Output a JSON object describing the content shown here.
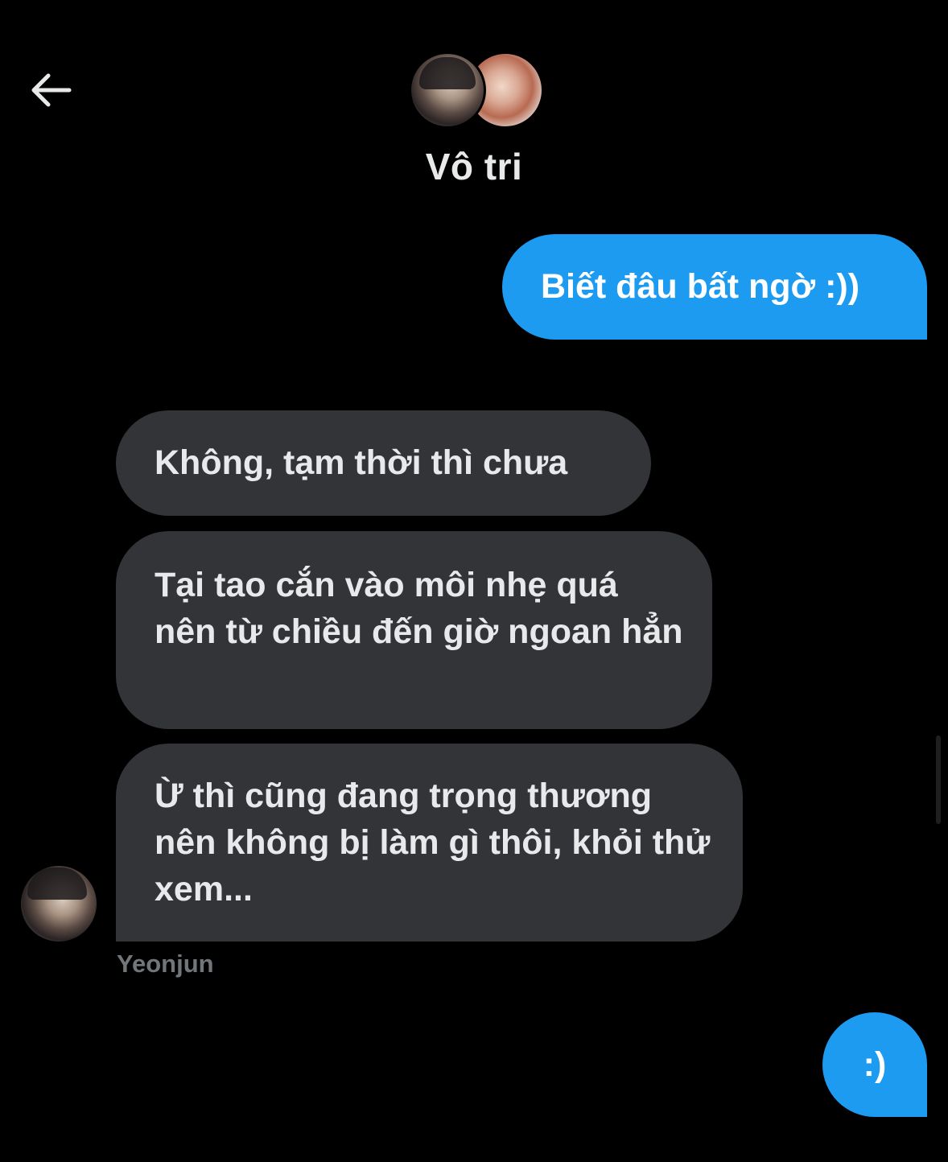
{
  "header": {
    "back_icon": "arrow-left-icon",
    "title": "Vô tri",
    "participants_icons": [
      "avatar",
      "avatar"
    ]
  },
  "messages": [
    {
      "direction": "sent",
      "text": "Biết đâu bất ngờ :))"
    },
    {
      "direction": "received",
      "text": "Không, tạm thời thì chưa"
    },
    {
      "direction": "received",
      "text": "Tại tao cắn vào môi nhẹ quá nên từ chiều đến giờ ngoan hẳn"
    },
    {
      "direction": "received",
      "text": "Ừ thì cũng đang trọng thương nên không bị làm gì thôi, khỏi thử xem..."
    },
    {
      "direction": "sent",
      "text": ":)"
    }
  ],
  "sender": {
    "name": "Yeonjun"
  },
  "colors": {
    "background": "#000000",
    "sent_bubble": "#1d9bf0",
    "received_bubble": "#333437",
    "text_primary": "#e7e9ea",
    "text_secondary": "#71767b"
  }
}
